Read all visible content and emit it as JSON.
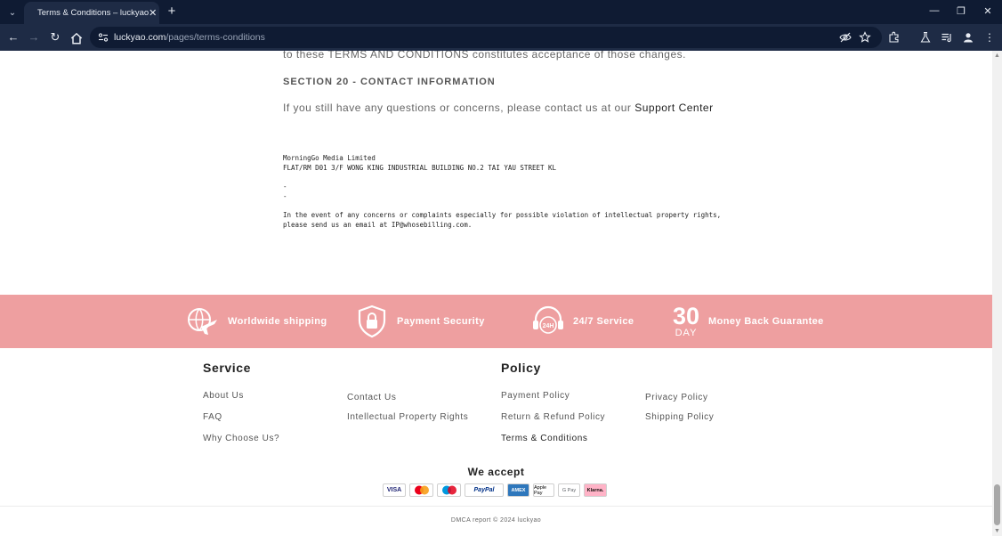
{
  "browser": {
    "tab_title": "Terms & Conditions – luckyao",
    "url_host": "luckyao.com",
    "url_path": "/pages/terms-conditions"
  },
  "content": {
    "partial_line": "to these TERMS AND CONDITIONS constitutes acceptance of those changes.",
    "section_heading": "SECTION 20 - CONTACT INFORMATION",
    "contact_text": "If you still have any questions or concerns, please contact us at our",
    "support_link": "Support Center",
    "company_name": "MorningGo Media Limited",
    "company_address": "FLAT/RM D01 3/F WONG KING INDUSTRIAL BUILDING NO.2 TAI YAU STREET KL",
    "dash_1": "-",
    "dash_2": "-",
    "ip_notice_line1": "In the event of any concerns or complaints especially for possible violation of intellectual property rights,",
    "ip_notice_line2": "please send us an email at IP@whosebilling.com."
  },
  "features": [
    {
      "icon": "plane-globe-icon",
      "label": "Worldwide shipping"
    },
    {
      "icon": "shield-lock-icon",
      "label": "Payment Security"
    },
    {
      "icon": "headset-24h-icon",
      "label": "24/7 Service",
      "badge": "24H"
    },
    {
      "icon": "30-day-icon",
      "label": "Money Back Guarantee",
      "number": "30",
      "word": "DAY"
    }
  ],
  "footer": {
    "service_heading": "Service",
    "service_links": [
      "About Us",
      "Contact Us",
      "FAQ",
      "Intellectual Property Rights",
      "Why Choose Us?"
    ],
    "policy_heading": "Policy",
    "policy_links": [
      "Payment Policy",
      "Privacy Policy",
      "Return & Refund Policy",
      "Shipping Policy",
      "Terms & Conditions"
    ],
    "accept_title": "We accept",
    "payment_methods": [
      "VISA",
      "mastercard",
      "maestro",
      "PayPal",
      "AMEX",
      "Apple Pay",
      "G Pay",
      "Klarna."
    ],
    "copyright": "DMCA report © 2024 luckyao"
  },
  "colors": {
    "feature_band": "#ee9fa0",
    "chrome_dark": "#0f1b33",
    "chrome_toolbar": "#1e2b45"
  }
}
